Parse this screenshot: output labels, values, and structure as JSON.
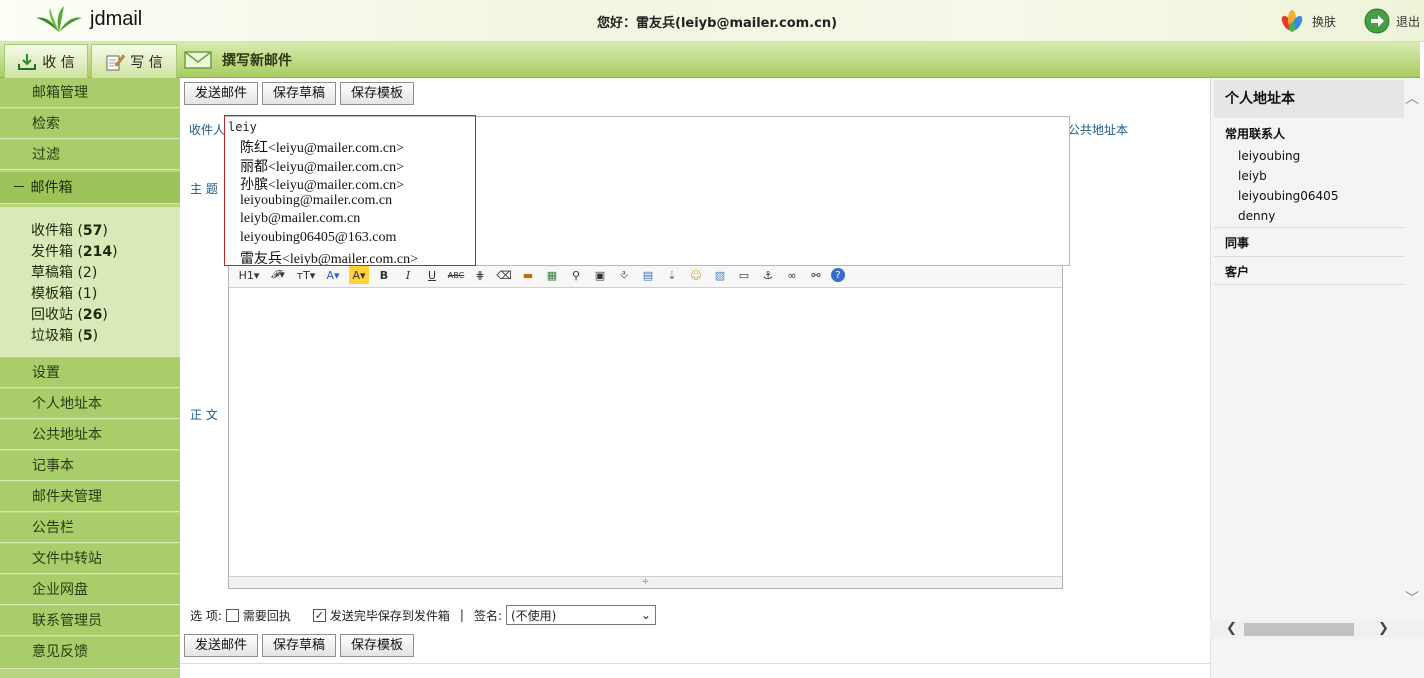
{
  "header": {
    "logo_text": "jdmail",
    "greeting": "您好：雷友兵(leiyb@mailer.com.cn)",
    "skin_label": "换肤",
    "logout_label": "退出"
  },
  "nav": {
    "inbox_label": "收 信",
    "write_label": "写 信",
    "compose_title": "撰写新邮件"
  },
  "sidebar": {
    "top_items": [
      "邮箱管理",
      "检索",
      "过滤"
    ],
    "mailbox_label": "－ 邮件箱",
    "folders": [
      {
        "name": "收件箱 (",
        "count": "57",
        "tail": ")"
      },
      {
        "name": "发件箱 (",
        "count": "214",
        "tail": ")"
      },
      {
        "name": "草稿箱 (",
        "count": "2",
        "tail": ")"
      },
      {
        "name": "模板箱 (",
        "count": "1",
        "tail": ")"
      },
      {
        "name": "回收站 (",
        "count": "26",
        "tail": ")"
      },
      {
        "name": "垃圾箱 (",
        "count": "5",
        "tail": ")"
      }
    ],
    "bottom_items": [
      "设置",
      "个人地址本",
      "公共地址本",
      "记事本",
      "邮件夹管理",
      "公告栏",
      "文件中转站",
      "企业网盘",
      "联系管理员",
      "意见反馈"
    ]
  },
  "compose": {
    "send_label": "发送邮件",
    "save_draft_label": "保存草稿",
    "save_template_label": "保存模板",
    "to_label": "收件人",
    "to_value": "leiy",
    "public_book_label": "公共地址本",
    "subject_label": "主 题",
    "body_label": "正 文",
    "autocomplete": [
      "陈红<leiyu@mailer.com.cn>",
      "丽都<leiyu@mailer.com.cn>",
      "孙膑<leiyu@mailer.com.cn>",
      "leiyoubing@mailer.com.cn",
      "leiyb@mailer.com.cn",
      "leiyoubing06405@163.com",
      "雷友兵<leiyb@mailer.com.cn>"
    ],
    "options_label": "选 项:",
    "receipt_label": "需要回执",
    "receipt_checked": false,
    "save_sent_label": "发送完毕保存到发件箱",
    "save_sent_checked": true,
    "separator": "|",
    "signature_label": "签名:",
    "signature_value": "(不使用)"
  },
  "right_panel": {
    "title": "个人地址本",
    "groups": [
      {
        "name": "常用联系人",
        "contacts": [
          "leiyoubing",
          "leiyb",
          "leiyoubing06405",
          "denny"
        ]
      },
      {
        "name": "同事",
        "contacts": []
      },
      {
        "name": "客户",
        "contacts": []
      }
    ]
  },
  "colors": {
    "accent_green": "#a9cd6a",
    "highlight_red": "#c0272d",
    "link_blue": "#1d5a8a"
  }
}
